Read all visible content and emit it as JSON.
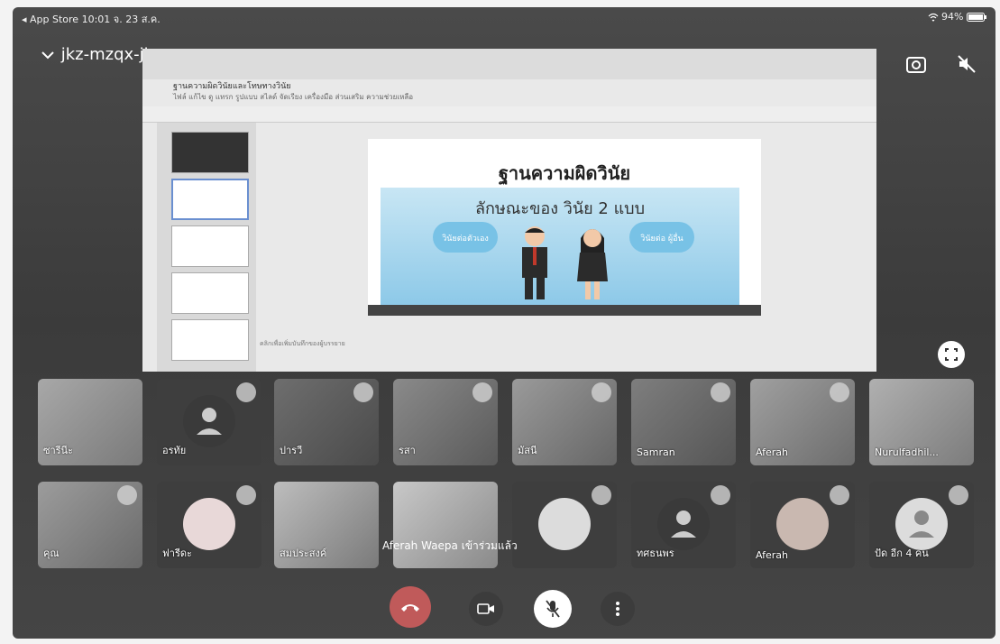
{
  "statusbar": {
    "left": "◂ App Store  10:01  จ. 23 ส.ค.",
    "right": "94%"
  },
  "meeting": {
    "code": "jkz-mzqx-jke"
  },
  "document": {
    "title": "ฐานความผิดวินัยและโทษทางวินัย",
    "menu": "ไฟล์  แก้ไข  ดู  แทรก  รูปแบบ  สไลด์  จัดเรียง  เครื่องมือ  ส่วนเสริม  ความช่วยเหลือ",
    "footer_note": "คลิกเพื่อเพิ่มบันทึกของผู้บรรยาย"
  },
  "slide": {
    "title": "ฐานความผิดวินัย",
    "subtitle": "ลักษณะของ วินัย 2 แบบ",
    "left_bubble": "วินัยต่อตัวเอง",
    "right_bubble": "วินัยต่อ ผู้อื่น"
  },
  "participants_row1": [
    {
      "name": "ซารีนีะ",
      "muted": false
    },
    {
      "name": "อรทัย",
      "muted": true
    },
    {
      "name": "ปารวี",
      "muted": true
    },
    {
      "name": "รสา",
      "muted": true
    },
    {
      "name": "มัสนี",
      "muted": true
    },
    {
      "name": "Samran",
      "muted": true
    },
    {
      "name": "Aferah",
      "muted": true
    },
    {
      "name": "Nurulfadhil...",
      "muted": false
    }
  ],
  "participants_row2": [
    {
      "name": "คุณ",
      "muted": true
    },
    {
      "name": "ฟารีดะ",
      "muted": true
    },
    {
      "name": "สมประสงค์",
      "muted": false
    },
    {
      "name": "",
      "muted": false
    },
    {
      "name": "",
      "muted": true
    },
    {
      "name": "ทศธนพร",
      "muted": true
    },
    {
      "name": "Aferah",
      "muted": true
    },
    {
      "name": "ปัด  อีก 4 คน",
      "muted": true
    }
  ],
  "toast": "Aferah Waepa เข้าร่วมแล้ว",
  "colors": {
    "end_call": "#c05a5a",
    "background": "#3d3d3d"
  }
}
